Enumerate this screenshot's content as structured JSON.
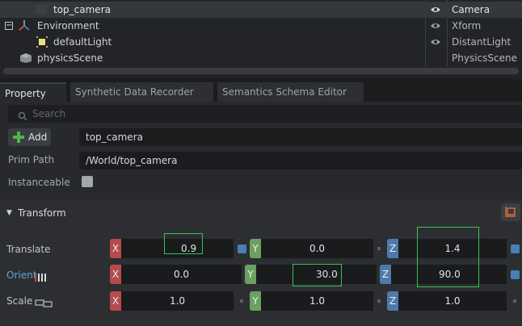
{
  "stage": {
    "rows": [
      {
        "name": "top_camera",
        "type": "Camera",
        "visible": true,
        "icon": "camera-icon"
      },
      {
        "name": "Environment",
        "type": "Xform",
        "visible": true,
        "icon": "xform-axes-icon"
      },
      {
        "name": "defaultLight",
        "type": "DistantLight",
        "visible": true,
        "icon": "light-icon"
      },
      {
        "name": "physicsScene",
        "type": "PhysicsScene",
        "visible": false,
        "icon": "cube-icon"
      }
    ]
  },
  "tabs": [
    {
      "label": "Property",
      "active": true
    },
    {
      "label": "Synthetic Data Recorder",
      "active": false
    },
    {
      "label": "Semantics Schema Editor",
      "active": false
    }
  ],
  "property": {
    "search_placeholder": "Search",
    "add_label": "Add",
    "prim_name": "top_camera",
    "prim_path_label": "Prim Path",
    "prim_path": "/World/top_camera",
    "instanceable_label": "Instanceable",
    "instanceable_checked": false
  },
  "transform": {
    "title": "Transform",
    "translate_label": "Translate",
    "orient_label": "Orient",
    "scale_label": "Scale",
    "axis_x": "X",
    "axis_y": "Y",
    "axis_z": "Z",
    "translate": {
      "x": "0.9",
      "y": "0.0",
      "z": "1.4"
    },
    "orient": {
      "x": "0.0",
      "y": "30.0",
      "z": "90.0"
    },
    "scale": {
      "x": "1.0",
      "y": "1.0",
      "z": "1.0"
    }
  },
  "colors": {
    "axis_x": "#b54b4b",
    "axis_y": "#6aa162",
    "axis_z": "#4d7aaa",
    "highlight": "#35c35a",
    "link": "#5fa8e0"
  }
}
